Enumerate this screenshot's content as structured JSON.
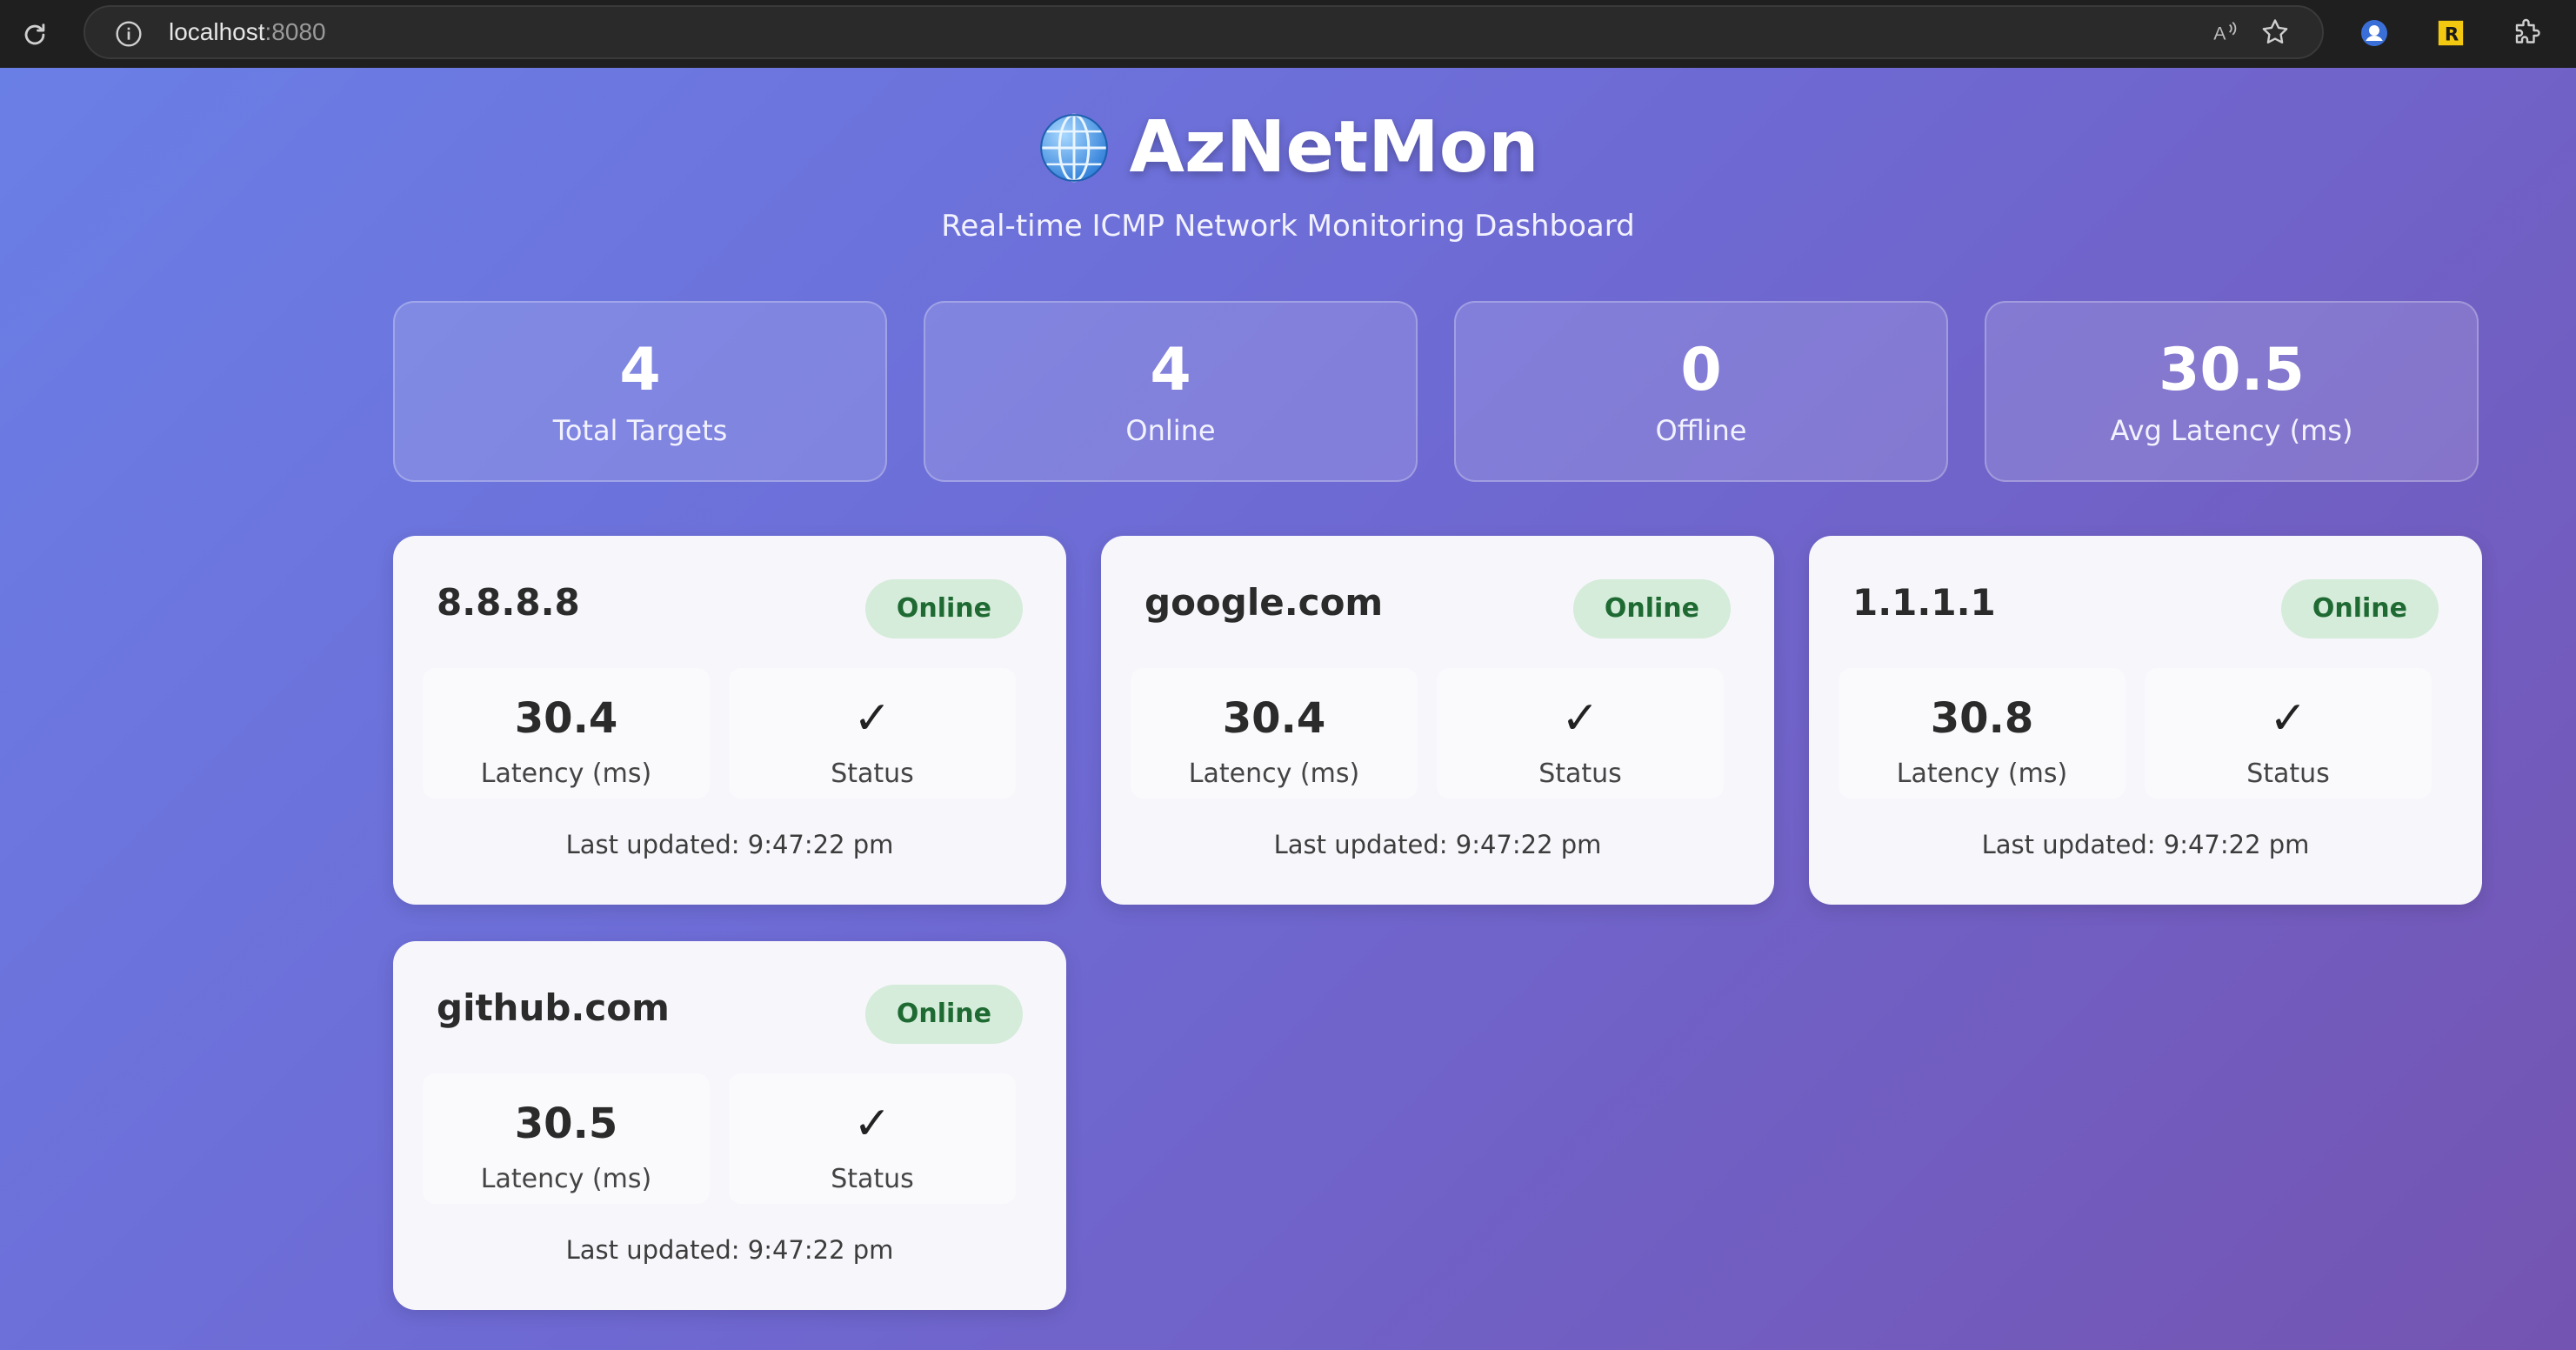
{
  "browser": {
    "url_host": "localhost",
    "url_port": ":8080"
  },
  "header": {
    "title": "AzNetMon",
    "subtitle": "Real-time ICMP Network Monitoring Dashboard"
  },
  "stats": [
    {
      "value": "4",
      "label": "Total Targets"
    },
    {
      "value": "4",
      "label": "Online"
    },
    {
      "value": "0",
      "label": "Offline"
    },
    {
      "value": "30.5",
      "label": "Avg Latency (ms)"
    }
  ],
  "targets": [
    {
      "host": "8.8.8.8",
      "status": "Online",
      "latency": "30.4",
      "latency_label": "Latency (ms)",
      "status_icon": "✓",
      "status_label": "Status",
      "updated": "Last updated: 9:47:22 pm"
    },
    {
      "host": "google.com",
      "status": "Online",
      "latency": "30.4",
      "latency_label": "Latency (ms)",
      "status_icon": "✓",
      "status_label": "Status",
      "updated": "Last updated: 9:47:22 pm"
    },
    {
      "host": "1.1.1.1",
      "status": "Online",
      "latency": "30.8",
      "latency_label": "Latency (ms)",
      "status_icon": "✓",
      "status_label": "Status",
      "updated": "Last updated: 9:47:22 pm"
    },
    {
      "host": "github.com",
      "status": "Online",
      "latency": "30.5",
      "latency_label": "Latency (ms)",
      "status_icon": "✓",
      "status_label": "Status",
      "updated": "Last updated: 9:47:22 pm"
    }
  ],
  "colors": {
    "online_badge_bg": "#d4ecd9",
    "online_badge_text": "#1f6a33",
    "gradient_start": "#6a7fe6",
    "gradient_end": "#7454b2"
  },
  "icons": {
    "reload": "reload-icon",
    "info": "info-icon",
    "read_aloud": "read-aloud-icon",
    "favorite": "star-icon",
    "profile": "profile-icon",
    "extension_r": "extension-r-icon",
    "extensions": "puzzle-icon",
    "logo": "globe-icon"
  }
}
